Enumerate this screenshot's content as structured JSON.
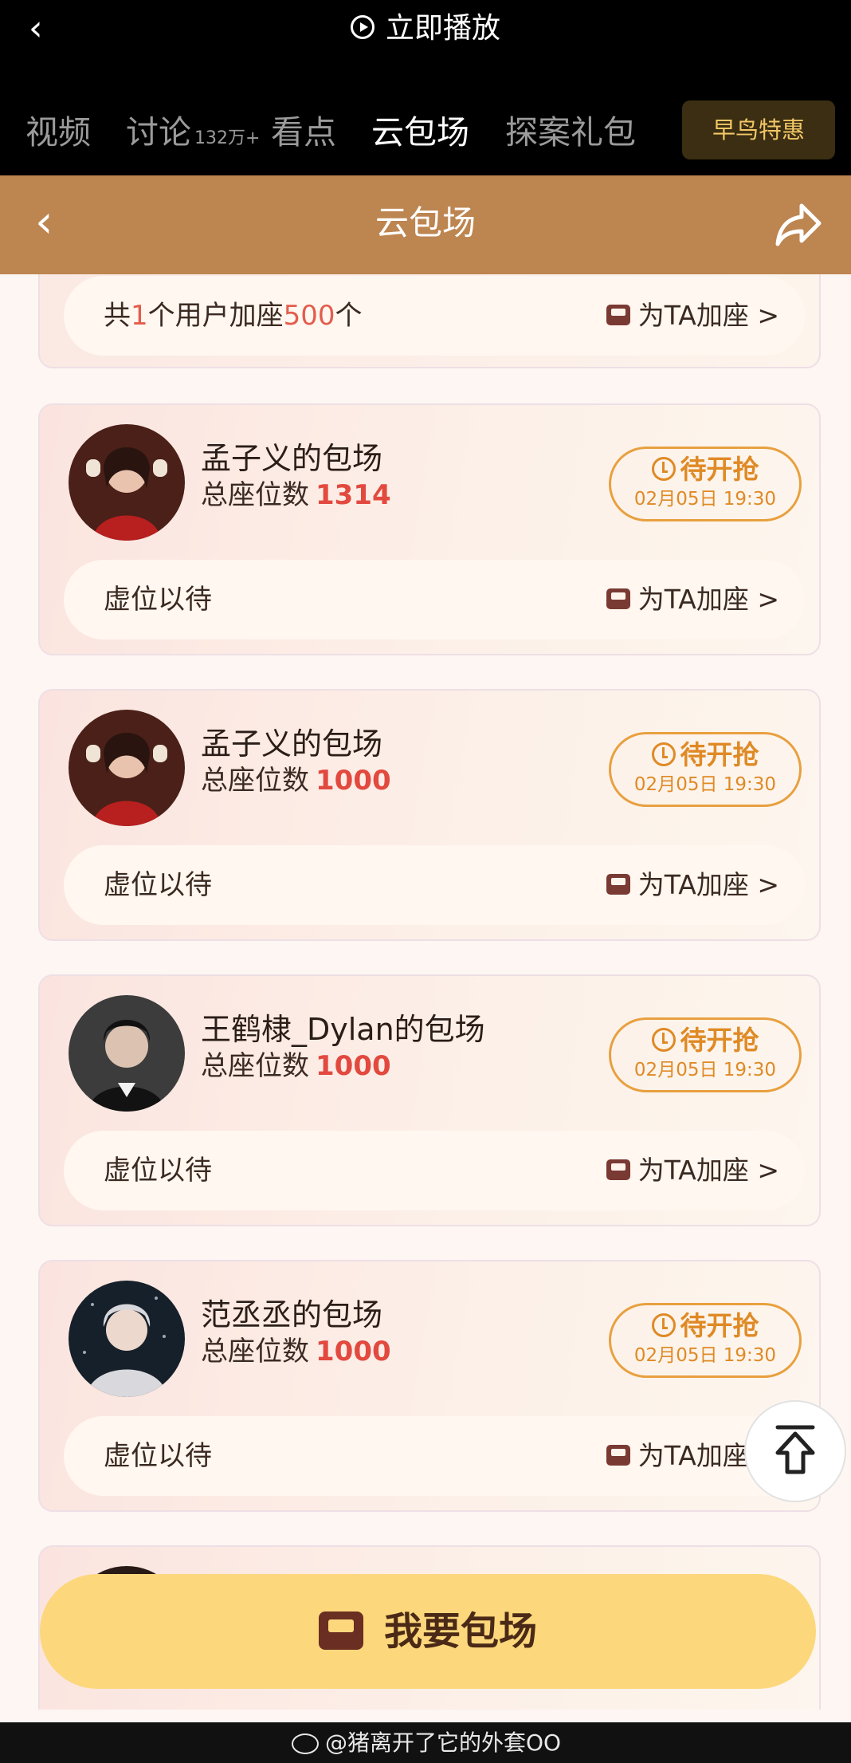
{
  "top_bar": {
    "title": "立即播放"
  },
  "tabs": [
    {
      "label": "视频",
      "count": ""
    },
    {
      "label": "讨论",
      "count": "132万+"
    },
    {
      "label": "看点",
      "count": ""
    },
    {
      "label": "云包场",
      "count": ""
    },
    {
      "label": "探案礼包",
      "count": ""
    }
  ],
  "early_bird": "早鸟特惠",
  "header": {
    "title": "云包场"
  },
  "partial": {
    "pre": "共",
    "users": "1",
    "mid": "个用户加座",
    "seats": "500",
    "post": "个",
    "add_label": "为TA加座 >"
  },
  "cards": [
    {
      "title": "孟子义的包场",
      "seats_label": "总座位数",
      "seats": "1314",
      "status": "待开抢",
      "time": "02月05日 19:30",
      "waiting": "虚位以待",
      "add_label": "为TA加座 >"
    },
    {
      "title": "孟子义的包场",
      "seats_label": "总座位数",
      "seats": "1000",
      "status": "待开抢",
      "time": "02月05日 19:30",
      "waiting": "虚位以待",
      "add_label": "为TA加座 >"
    },
    {
      "title": "王鹤棣_Dylan的包场",
      "seats_label": "总座位数",
      "seats": "1000",
      "status": "待开抢",
      "time": "02月05日 19:30",
      "waiting": "虚位以待",
      "add_label": "为TA加座 >"
    },
    {
      "title": "范丞丞的包场",
      "seats_label": "总座位数",
      "seats": "1000",
      "status": "待开抢",
      "time": "02月05日 19:30",
      "waiting": "虚位以待",
      "add_label": "为TA加座 >"
    }
  ],
  "cta": "我要包场",
  "watermark": "@猪离开了它的外套OO",
  "colors": {
    "header": "#bd8550",
    "accent": "#df8a25",
    "seat_number": "#e2493f",
    "cta": "#fcd77c"
  }
}
